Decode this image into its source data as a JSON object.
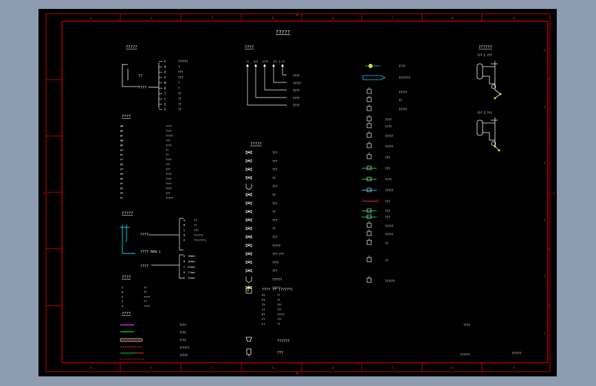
{
  "drawing": {
    "title": "?????",
    "top_column_labels": [
      "H",
      "G",
      "F",
      "E",
      "D",
      "C",
      "B",
      "A"
    ],
    "bottom_column_labels": [
      "H",
      "G",
      "F",
      "E",
      "D",
      "C",
      "B",
      "A"
    ],
    "row_labels": [
      "6",
      "5",
      "4",
      "3",
      "2",
      "1"
    ],
    "edge_marks": {
      "top": "W",
      "bottom": "W",
      "left": "X",
      "right": "X"
    },
    "colors": {
      "frame": "#ff0000",
      "text": "#ffffff",
      "accent": "#ffe600",
      "cyan": "#00e5ff",
      "green": "#00e040",
      "magenta": "#e040ff"
    }
  },
  "designation": {
    "heading": "?????",
    "inner_label": "??",
    "outer_label": "????",
    "codes": [
      "C",
      "O",
      "X",
      "F",
      "W",
      "D",
      "T",
      "L",
      "S",
      "F"
    ],
    "meanings": [
      "??????",
      "?",
      "???",
      "???",
      "?",
      "?",
      "??",
      "??",
      "??",
      "??"
    ]
  },
  "abbreviations": {
    "heading": "????",
    "codes": [
      "BB",
      "BE",
      "BF",
      "BM",
      "BP",
      "BT",
      "DC",
      "FT",
      "HA",
      "HI",
      "RO",
      "RP",
      "RY",
      "RV",
      "PE",
      "PC"
    ],
    "meanings": [
      "????",
      "????",
      "?????",
      "???",
      "????",
      "??",
      "??",
      "????",
      "???",
      "???",
      "????",
      "????",
      "????",
      "????",
      "???",
      "?????"
    ]
  },
  "line_legend": {
    "heading": "?????",
    "inner_label": "????",
    "outer_label": "????",
    "mid_label": "PN50   1",
    "upper_codes": [
      "A",
      "B",
      "C",
      "D",
      "E"
    ],
    "upper_meanings": [
      "??",
      "??",
      "???",
      "??(??)",
      "???(???)"
    ],
    "lower_codes": [
      "A",
      "B",
      "C",
      "D",
      "E"
    ],
    "lower_meanings": [
      "10bar",
      "16bar",
      "25bar",
      "??bar",
      "15bar"
    ]
  },
  "sizes": {
    "heading": "????",
    "codes": [
      "C",
      "E",
      "F",
      "F",
      "S"
    ],
    "values": [
      "??",
      "??",
      "????",
      "??",
      "????"
    ]
  },
  "pipe_types": {
    "heading": "????",
    "labels": [
      "????",
      "????",
      "????",
      "??????",
      "?????"
    ]
  },
  "numbering": {
    "heading": "????",
    "formula": "??  -  2??  -  2???  -  2??  2-??",
    "labels": [
      "????",
      "?????",
      "????",
      "????",
      "????"
    ]
  },
  "valves": {
    "heading": "?????",
    "labels": [
      "???",
      "???",
      "???",
      "??",
      "???",
      "??",
      "???",
      "??",
      "???",
      "??",
      "???",
      "?????",
      "???-???",
      "????",
      "???",
      "??????",
      "?????"
    ]
  },
  "instruments": {
    "heading": "???? ?? (?????)",
    "codes": [
      "PI",
      "FI",
      "TI",
      "LI",
      "PT",
      "FT",
      "LT"
    ],
    "labels": [
      "??",
      "??",
      "???",
      "???",
      "?????",
      "???",
      "??"
    ]
  },
  "equipment": {
    "labels": [
      "????",
      "???????",
      "?????",
      "??",
      "?????",
      "????",
      "????",
      "?????",
      "?????",
      "???",
      "???",
      "????",
      "?????",
      "???",
      "???",
      "???",
      "?????",
      "?????",
      "??",
      "??",
      "??????"
    ]
  },
  "loops": {
    "loop1_label": "??? 1  ???",
    "loop2_label": "??? 2  ???",
    "heading": "??????"
  },
  "titleblock": {
    "note": "????",
    "drawing_no": "??????",
    "scale": "??????"
  }
}
